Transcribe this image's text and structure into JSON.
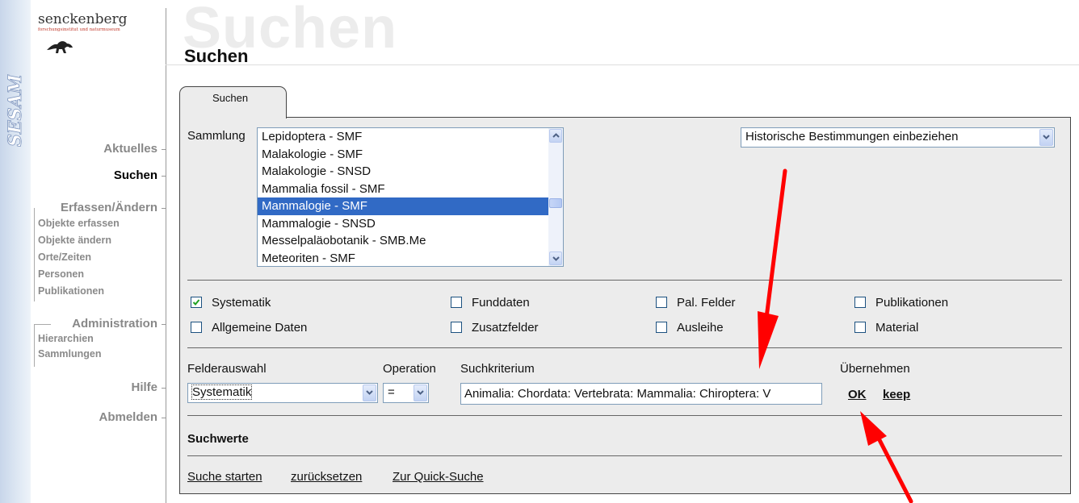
{
  "brand": {
    "name": "senckenberg",
    "subtitle": "forschungsinstitut und naturmuseum",
    "app_name": "SESAM"
  },
  "header": {
    "ghost_title": "Suchen",
    "title": "Suchen"
  },
  "nav": {
    "aktuelles": "Aktuelles",
    "suchen": "Suchen",
    "erfassen": "Erfassen/Ändern",
    "erfassen_items": [
      "Objekte erfassen",
      "Objekte ändern",
      "Orte/Zeiten",
      "Personen",
      "Publikationen"
    ],
    "administration": "Administration",
    "admin_items": [
      "Hierarchien",
      "Sammlungen"
    ],
    "hilfe": "Hilfe",
    "abmelden": "Abmelden"
  },
  "tab": {
    "label": "Suchen"
  },
  "sammlung": {
    "label": "Sammlung",
    "options": [
      "Lepidoptera - SMF",
      "Malakologie - SMF",
      "Malakologie - SNSD",
      "Mammalia fossil - SMF",
      "Mammalogie - SMF",
      "Mammalogie - SNSD",
      "Messelpaläobotanik - SMB.Me",
      "Meteoriten - SMF"
    ],
    "selected": "Mammalogie - SMF"
  },
  "historic_select": {
    "value": "Historische Bestimmungen einbeziehen"
  },
  "checkboxes": {
    "systematik": {
      "label": "Systematik",
      "checked": true
    },
    "funddaten": {
      "label": "Funddaten",
      "checked": false
    },
    "pal_felder": {
      "label": "Pal. Felder",
      "checked": false
    },
    "publikationen": {
      "label": "Publikationen",
      "checked": false
    },
    "allgemeine_daten": {
      "label": "Allgemeine Daten",
      "checked": false
    },
    "zusatzfelder": {
      "label": "Zusatzfelder",
      "checked": false
    },
    "ausleihe": {
      "label": "Ausleihe",
      "checked": false
    },
    "material": {
      "label": "Material",
      "checked": false
    }
  },
  "criteria": {
    "felderauswahl_label": "Felderauswahl",
    "operation_label": "Operation",
    "suchkriterium_label": "Suchkriterium",
    "uebernehmen_label": "Übernehmen",
    "field_value": "Systematik",
    "operation_value": "=",
    "criterion_value": "Animalia: Chordata: Vertebrata: Mammalia: Chiroptera: V",
    "ok_label": "OK",
    "keep_label": "keep"
  },
  "suchwerte": {
    "label": "Suchwerte"
  },
  "actions": {
    "start": "Suche starten",
    "reset": "zurücksetzen",
    "quick": "Zur Quick-Suche"
  },
  "colors": {
    "selection": "#316ac5",
    "annotation_arrow": "#ff0000",
    "panel": "#ececec"
  }
}
